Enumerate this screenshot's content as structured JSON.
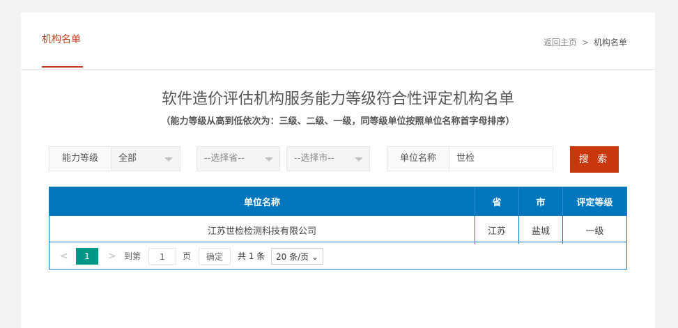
{
  "tab": {
    "label": "机构名单"
  },
  "breadcrumb": {
    "home": "返回主页",
    "sep": ">",
    "current": "机构名单"
  },
  "title": "软件造价评估机构服务能力等级符合性评定机构名单",
  "subtitle": "（能力等级从高到低依次为：三级、二级、一级，同等级单位按照单位名称首字母排序）",
  "filters": {
    "level_label": "能力等级",
    "level_value": "全部",
    "province_placeholder": "--选择省--",
    "city_placeholder": "--选择市--",
    "name_label": "单位名称",
    "name_value": "世检"
  },
  "search_button": "搜 索",
  "table": {
    "headers": [
      "单位名称",
      "省",
      "市",
      "评定等级"
    ],
    "rows": [
      [
        "江苏世检检测科技有限公司",
        "江苏",
        "盐城",
        "一级"
      ]
    ]
  },
  "pagination": {
    "prev": "<",
    "current_page": "1",
    "next": ">",
    "goto_label": "到第",
    "goto_value": "1",
    "page_unit": "页",
    "confirm": "确定",
    "total": "共 1 条",
    "per_page": "20 条/页"
  },
  "colors": {
    "accent": "#c9370d",
    "table_header": "#0077bd",
    "page_active": "#009688"
  }
}
